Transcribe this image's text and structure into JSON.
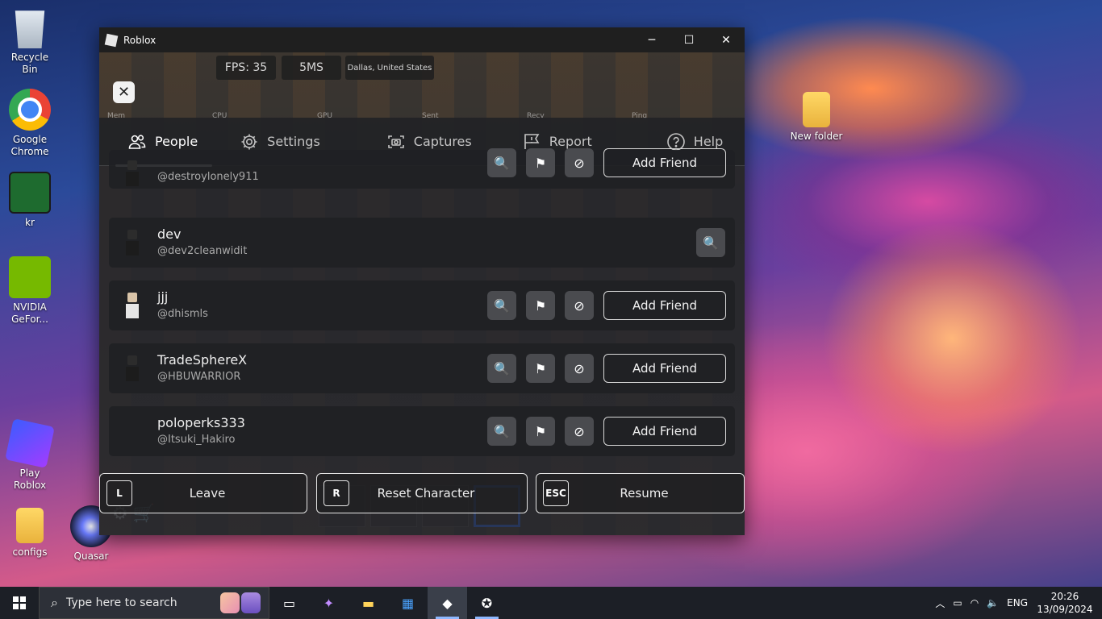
{
  "desktop": {
    "icons": [
      {
        "label": "Recycle Bin",
        "icon": "recycle-bin-icon"
      },
      {
        "label": "Google Chrome",
        "icon": "chrome-icon"
      },
      {
        "label": "kr",
        "icon": "kr-icon"
      },
      {
        "label": "NVIDIA GeFor...",
        "icon": "nvidia-icon"
      },
      {
        "label": "Play Roblox",
        "icon": "roblox-icon"
      },
      {
        "label": "configs",
        "icon": "folder-icon"
      },
      {
        "label": "Quasar",
        "icon": "quasar-icon"
      },
      {
        "label": "New folder",
        "icon": "folder-icon"
      }
    ]
  },
  "window": {
    "title": "Roblox",
    "minimize": "─",
    "maximize": "☐",
    "close": "✕"
  },
  "game": {
    "close_menu": "✕",
    "fps": "FPS: 35",
    "ping_ms": "5MS",
    "location": "Dallas, United States",
    "mini_stats": [
      "Mem",
      "CPU",
      "GPU",
      "Sent",
      "Recv",
      "Ping"
    ]
  },
  "tabs": [
    {
      "label": "People",
      "icon": "people-icon",
      "active": true
    },
    {
      "label": "Settings",
      "icon": "gear-icon",
      "active": false
    },
    {
      "label": "Captures",
      "icon": "camera-icon",
      "active": false
    },
    {
      "label": "Report",
      "icon": "report-flag-icon",
      "active": false
    },
    {
      "label": "Help",
      "icon": "help-icon",
      "active": false
    }
  ],
  "players": [
    {
      "display": "",
      "username": "@destroylonely911",
      "add_friend": "Add Friend"
    },
    {
      "display": "dev",
      "username": "@dev2cleanwidit",
      "add_friend": ""
    },
    {
      "display": "jjj",
      "username": "@dhismls",
      "add_friend": "Add Friend"
    },
    {
      "display": "TradeSphereX",
      "username": "@HBUWARRIOR",
      "add_friend": "Add Friend"
    },
    {
      "display": "poloperks333",
      "username": "@Itsuki_Hakiro",
      "add_friend": "Add Friend"
    }
  ],
  "bottom_actions": [
    {
      "key": "L",
      "label": "Leave"
    },
    {
      "key": "R",
      "label": "Reset Character"
    },
    {
      "key": "ESC",
      "label": "Resume"
    }
  ],
  "taskbar": {
    "search_placeholder": "Type here to search",
    "language": "ENG",
    "time": "20:26",
    "date": "13/09/2024"
  }
}
